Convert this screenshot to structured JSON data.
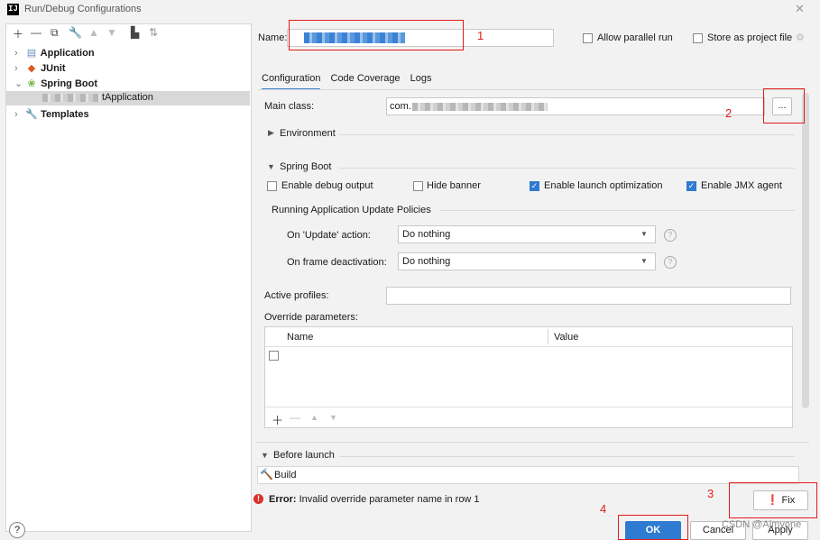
{
  "window": {
    "title": "Run/Debug Configurations",
    "logo": "IJ"
  },
  "left_toolbar": {
    "icons": [
      "add-icon",
      "remove-icon",
      "copy-icon",
      "wrench-icon",
      "move-up-icon",
      "move-down-icon",
      "folder-icon",
      "sort-icon"
    ]
  },
  "tree": {
    "items": [
      {
        "label": "Application"
      },
      {
        "label": "JUnit"
      },
      {
        "label": "Spring Boot"
      },
      {
        "label": "tApplication"
      },
      {
        "label": "Templates"
      }
    ]
  },
  "form": {
    "name_label": "Name:",
    "allow_parallel_label": "Allow parallel run",
    "store_project_label": "Store as project file",
    "tabs": [
      "Configuration",
      "Code Coverage",
      "Logs"
    ],
    "main_class_label": "Main class:",
    "main_class_value": "com.",
    "browse_label": "...",
    "environment_label": "Environment",
    "spring_boot_label": "Spring Boot",
    "enable_debug_label": "Enable debug output",
    "hide_banner_label": "Hide banner",
    "enable_launch_label": "Enable launch optimization",
    "enable_jmx_label": "Enable JMX agent",
    "policies_label": "Running Application Update Policies",
    "on_update_label": "On 'Update' action:",
    "on_update_value": "Do nothing",
    "on_frame_label": "On frame deactivation:",
    "on_frame_value": "Do nothing",
    "active_profiles_label": "Active profiles:",
    "override_label": "Override parameters:",
    "table_headers": [
      "Name",
      "Value"
    ],
    "before_launch_label": "Before launch",
    "build_label": "Build"
  },
  "error": {
    "prefix": "Error:",
    "message": "Invalid override parameter name in row 1",
    "fix_label": "Fix"
  },
  "buttons": {
    "ok": "OK",
    "cancel": "Cancel",
    "apply": "Apply",
    "help": "?"
  },
  "annotations": {
    "n1": "1",
    "n2": "2",
    "n3": "3",
    "n4": "4"
  },
  "watermark": "CSDN @Aimyone",
  "colors": {
    "annotation": "#e31b1b",
    "ok_button": "#2f7bd1",
    "checkbox_checked": "#2f7bd1",
    "error": "#d9302c"
  }
}
